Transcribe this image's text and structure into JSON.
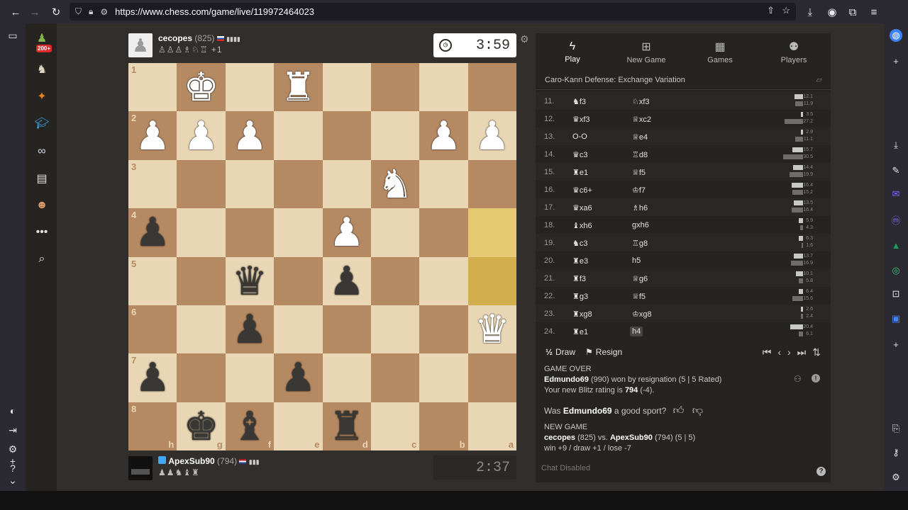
{
  "browser": {
    "url": "https://www.chess.com/game/live/119972464023",
    "icons": [
      "back-icon",
      "forward-icon",
      "reload-icon",
      "shield-icon",
      "lock-icon",
      "tune-icon",
      "share-icon",
      "star-icon",
      "download-icon",
      "account-icon",
      "extension-icon",
      "menu-icon"
    ]
  },
  "nav": {
    "badge": "200+"
  },
  "top_player": {
    "name": "cecopes",
    "rating": "(825)",
    "captures": "♙♙♙♗♘♖ +1",
    "clock": "3:59"
  },
  "bottom_player": {
    "name": "ApexSub90",
    "rating": "(794)",
    "captures": "♟♟♞♝♜",
    "clock": "2:37"
  },
  "board": {
    "ranks": [
      "1",
      "2",
      "3",
      "4",
      "5",
      "6",
      "7",
      "8"
    ],
    "files": [
      "h",
      "g",
      "f",
      "e",
      "d",
      "c",
      "b",
      "a"
    ],
    "squares": [
      [
        "",
        "wK",
        "",
        "wR",
        "",
        "",
        "",
        ""
      ],
      [
        "wP",
        "wP",
        "wP",
        "",
        "",
        "",
        "wP",
        "wP"
      ],
      [
        "",
        "",
        "",
        "",
        "",
        "wN",
        "",
        ""
      ],
      [
        "bP",
        "",
        "",
        "",
        "wP",
        "",
        "",
        ""
      ],
      [
        "",
        "",
        "bQ",
        "",
        "bP",
        "",
        "",
        ""
      ],
      [
        "",
        "",
        "bP",
        "",
        "",
        "",
        "",
        "wQ"
      ],
      [
        "bP",
        "",
        "",
        "bP",
        "",
        "",
        "",
        ""
      ],
      [
        "",
        "bK",
        "bB",
        "",
        "bR",
        "",
        "",
        ""
      ]
    ],
    "highlights": [
      "a4",
      "a5"
    ]
  },
  "panel": {
    "tabs": [
      {
        "label": "Play",
        "icon": "bolt-icon"
      },
      {
        "label": "New Game",
        "icon": "plus-icon"
      },
      {
        "label": "Games",
        "icon": "board-icon"
      },
      {
        "label": "Players",
        "icon": "players-icon"
      }
    ],
    "opening": "Caro-Kann Defense: Exchange Variation",
    "moves": [
      {
        "n": "11.",
        "w": "♞f3",
        "b": "♘xf3",
        "t": [
          "12.1",
          "11.9"
        ],
        "f": [
          12,
          11
        ]
      },
      {
        "n": "12.",
        "w": "♛xf3",
        "b": "♕xc2",
        "t": [
          "3.5",
          "27.2"
        ],
        "f": [
          3,
          26
        ]
      },
      {
        "n": "13.",
        "w": "O-O",
        "b": "♕e4",
        "t": [
          "2.9",
          "11.1"
        ],
        "f": [
          3,
          11
        ]
      },
      {
        "n": "14.",
        "w": "♛c3",
        "b": "♖d8",
        "t": [
          "15.7",
          "30.5"
        ],
        "f": [
          15,
          28
        ]
      },
      {
        "n": "15.",
        "w": "♜e1",
        "b": "♕f5",
        "t": [
          "14.4",
          "19.9"
        ],
        "f": [
          14,
          19
        ]
      },
      {
        "n": "16.",
        "w": "♛c6+",
        "b": "♔f7",
        "t": [
          "16.4",
          "15.2"
        ],
        "f": [
          16,
          15
        ]
      },
      {
        "n": "17.",
        "w": "♛xa6",
        "b": "♗h6",
        "t": [
          "13.5",
          "16.4"
        ],
        "f": [
          13,
          16
        ]
      },
      {
        "n": "18.",
        "w": "♝xh6",
        "b": "gxh6",
        "t": [
          "5.9",
          "4.3"
        ],
        "f": [
          6,
          4
        ]
      },
      {
        "n": "19.",
        "w": "♞c3",
        "b": "♖g8",
        "t": [
          "6.3",
          "1.6"
        ],
        "f": [
          6,
          2
        ]
      },
      {
        "n": "20.",
        "w": "♜e3",
        "b": "h5",
        "t": [
          "13.7",
          "16.9"
        ],
        "f": [
          13,
          17
        ]
      },
      {
        "n": "21.",
        "w": "♜f3",
        "b": "♕g6",
        "t": [
          "10.1",
          "5.8"
        ],
        "f": [
          10,
          6
        ]
      },
      {
        "n": "22.",
        "w": "♜g3",
        "b": "♕f5",
        "t": [
          "6.4",
          "15.6"
        ],
        "f": [
          6,
          15
        ]
      },
      {
        "n": "23.",
        "w": "♜xg8",
        "b": "♔xg8",
        "t": [
          "2.6",
          "2.4"
        ],
        "f": [
          3,
          3
        ]
      },
      {
        "n": "24.",
        "w": "♜e1",
        "b": "h4",
        "t": [
          "20.4",
          "6.1"
        ],
        "f": [
          18,
          6
        ]
      }
    ],
    "draw": "Draw",
    "resign": "Resign",
    "gameover": {
      "title": "GAME OVER",
      "winner": "Edmundo69",
      "winner_detail": "(990) won by resignation (5 | 5 Rated)",
      "rating_line_pre": "Your new Blitz rating is",
      "rating_value": "794",
      "rating_delta": "(-4).",
      "sport_pre": "Was",
      "sport_name": "Edmundo69",
      "sport_post": "a good sport?",
      "new_game": "NEW GAME",
      "ng_white": "cecopes",
      "ng_line": "(825) vs.",
      "ng_black": "ApexSub90",
      "ng_line2": "(794) (5 | 5)",
      "record": "win +9 / draw +1 / lose -7"
    },
    "chat": "Chat Disabled"
  }
}
